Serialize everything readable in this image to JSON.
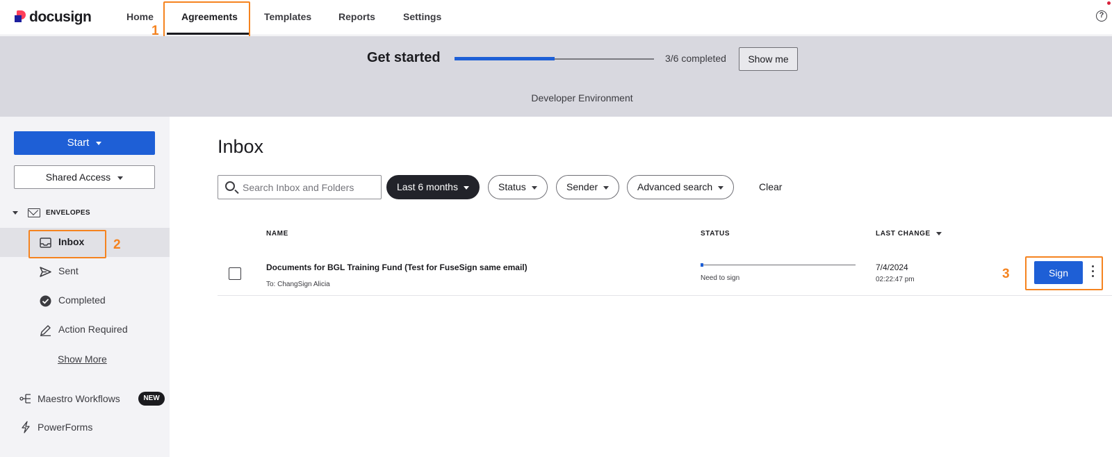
{
  "brand": {
    "name": "docusign"
  },
  "nav": {
    "items": [
      {
        "label": "Home"
      },
      {
        "label": "Agreements"
      },
      {
        "label": "Templates"
      },
      {
        "label": "Reports"
      },
      {
        "label": "Settings"
      }
    ],
    "active": "Agreements",
    "help_icon": "question-circle-icon",
    "help_glyph": "?"
  },
  "annotations": {
    "step1": "1",
    "step2": "2",
    "step3": "3",
    "color": "#f5831f"
  },
  "banner": {
    "title": "Get started",
    "progress_fraction": 0.5,
    "progress_text": "3/6 completed",
    "show_me_label": "Show me",
    "environment": "Developer Environment"
  },
  "sidebar": {
    "start_label": "Start",
    "shared_access_label": "Shared Access",
    "envelopes_header": "ENVELOPES",
    "items": [
      {
        "label": "Inbox",
        "icon": "inbox-icon"
      },
      {
        "label": "Sent",
        "icon": "send-icon"
      },
      {
        "label": "Completed",
        "icon": "check-circle-icon"
      },
      {
        "label": "Action Required",
        "icon": "pen-icon"
      }
    ],
    "show_more": "Show More",
    "maestro_label": "Maestro Workflows",
    "new_badge": "NEW",
    "powerforms_label": "PowerForms"
  },
  "main": {
    "title": "Inbox",
    "search": {
      "placeholder": "Search Inbox and Folders",
      "value": ""
    },
    "filters": {
      "date": "Last 6 months",
      "status": "Status",
      "sender": "Sender",
      "advanced": "Advanced search"
    },
    "clear_label": "Clear",
    "columns": {
      "name": "NAME",
      "status": "STATUS",
      "last_change": "LAST CHANGE"
    },
    "rows": [
      {
        "name": "Documents for BGL Training Fund (Test for FuseSign same email)",
        "to": "To: ChangSign Alicia",
        "status_progress_fraction": 0.02,
        "status_text": "Need to sign",
        "date": "7/4/2024",
        "time": "02:22:47 pm",
        "action_label": "Sign"
      }
    ]
  },
  "colors": {
    "accent": "#1e5fd6",
    "banner_bg": "#d8d8df",
    "sidebar_bg": "#f3f3f6"
  }
}
